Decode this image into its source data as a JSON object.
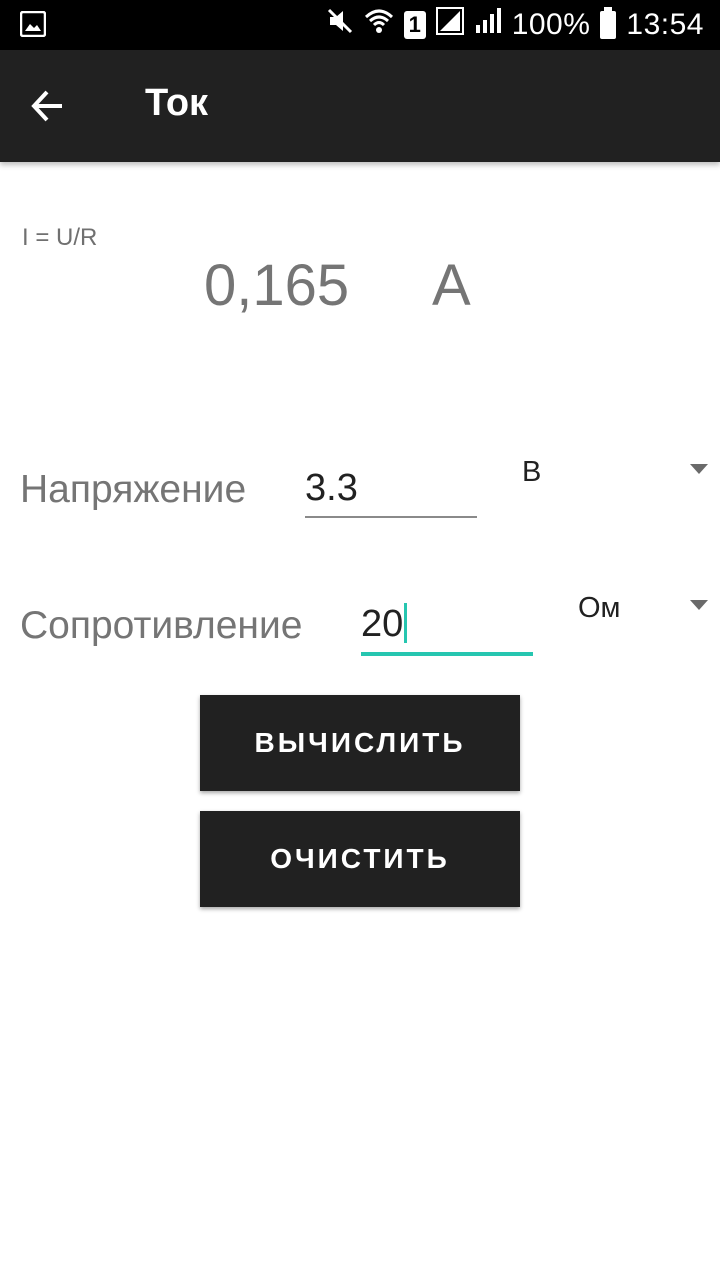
{
  "status_bar": {
    "battery": "100%",
    "time": "13:54",
    "sim_slot": "1",
    "icons": [
      "image-icon",
      "mute-icon",
      "wifi-icon",
      "sim-icon",
      "signal-icon",
      "signal-icon",
      "battery-icon"
    ]
  },
  "toolbar": {
    "title": "Ток",
    "back_icon": "arrow-left-icon"
  },
  "formula": "I = U/R",
  "result": {
    "value": "0,165",
    "unit": "A"
  },
  "voltage": {
    "label": "Напряжение",
    "value": "3.3",
    "unit": "В"
  },
  "resistance": {
    "label": "Сопротивление",
    "value": "20",
    "unit": "Ом"
  },
  "buttons": {
    "calculate": "ВЫЧИСЛИТЬ",
    "clear": "ОЧИСТИТЬ"
  },
  "colors": {
    "toolbar": "#212121",
    "accent": "#26c6b0",
    "button": "#212121"
  }
}
